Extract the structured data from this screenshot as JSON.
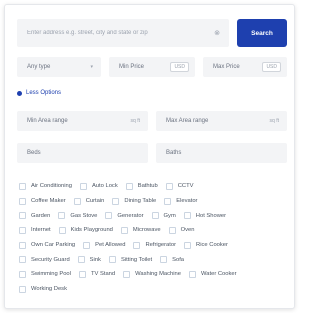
{
  "search": {
    "placeholder": "Enter address e.g. street, city and state or zip",
    "clear_glyph": "⊗",
    "button_label": "Search"
  },
  "filters": {
    "type": {
      "selected": "Any type",
      "caret": "▾"
    },
    "min_price": {
      "label": "Min Price",
      "unit": "USD"
    },
    "max_price": {
      "label": "Max Price",
      "unit": "USD"
    }
  },
  "less_options_label": "Less Options",
  "area": {
    "min": {
      "label": "Min Area range",
      "suffix": "sq ft"
    },
    "max": {
      "label": "Max Area range",
      "suffix": "sq ft"
    }
  },
  "rooms": {
    "beds_label": "Beds",
    "baths_label": "Baths"
  },
  "amenities": [
    [
      "Air Conditioning",
      "Auto Lock",
      "Bathtub",
      "CCTV"
    ],
    [
      "Coffee Maker",
      "Curtain",
      "Dining Table",
      "Elevator"
    ],
    [
      "Garden",
      "Gas Stove",
      "Generator",
      "Gym",
      "Hot Shower"
    ],
    [
      "Internet",
      "Kids Playground",
      "Microwave",
      "Oven"
    ],
    [
      "Own Car Parking",
      "Pet Allowed",
      "Refrigerator",
      "Rice Cooker"
    ],
    [
      "Security Guard",
      "Sink",
      "Sitting Toilet",
      "Sofa"
    ],
    [
      "Swimming Pool",
      "TV Stand",
      "Washing Machine",
      "Water Cooker"
    ],
    [
      "Working Desk"
    ]
  ],
  "colors": {
    "accent": "#1e40af",
    "field_bg": "#f3f4f6"
  }
}
